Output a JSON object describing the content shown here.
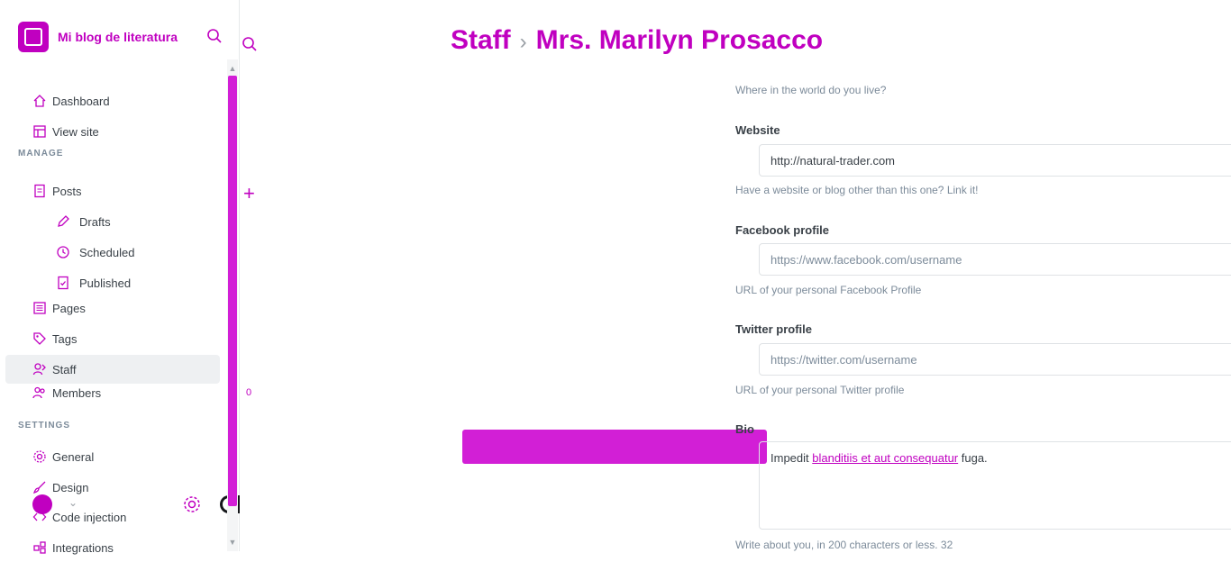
{
  "brand": {
    "name": "Mi blog de literatura",
    "logo_icon": "ghost-logo-icon"
  },
  "sidebar": {
    "search_icon": "search-icon",
    "top_items": [
      {
        "label": "Dashboard",
        "icon": "home-icon"
      },
      {
        "label": "View site",
        "icon": "layout-icon"
      }
    ],
    "manage_title": "MANAGE",
    "manage_items": [
      {
        "label": "Posts",
        "icon": "document-icon"
      },
      {
        "label": "Drafts",
        "icon": "pencil-icon"
      },
      {
        "label": "Scheduled",
        "icon": "clock-icon"
      },
      {
        "label": "Published",
        "icon": "published-icon"
      },
      {
        "label": "Pages",
        "icon": "pages-icon"
      },
      {
        "label": "Tags",
        "icon": "tag-icon"
      },
      {
        "label": "Staff",
        "icon": "staff-icon"
      },
      {
        "label": "Members",
        "icon": "members-icon"
      }
    ],
    "settings_title": "SETTINGS",
    "settings_items": [
      {
        "label": "General",
        "icon": "gear-icon"
      },
      {
        "label": "Design",
        "icon": "brush-icon"
      },
      {
        "label": "Code injection",
        "icon": "code-icon"
      },
      {
        "label": "Integrations",
        "icon": "integrations-icon"
      }
    ]
  },
  "header": {
    "section": "Staff",
    "separator": "›",
    "user": "Mrs. Marilyn Prosacco"
  },
  "gutter": {
    "add_symbol": "+",
    "count": "0"
  },
  "form": {
    "location_help": "Where in the world do you live?",
    "website": {
      "label": "Website",
      "value": "http://natural-trader.com",
      "help": "Have a website or blog other than this one? Link it!"
    },
    "facebook": {
      "label": "Facebook profile",
      "placeholder": "https://www.facebook.com/username",
      "help": "URL of your personal Facebook Profile"
    },
    "twitter": {
      "label": "Twitter profile",
      "placeholder": "https://twitter.com/username",
      "help": "URL of your personal Twitter profile"
    },
    "bio": {
      "label": "Bio",
      "value_prefix": "Impedit ",
      "value_link": "blanditiis et aut consequatur",
      "value_suffix": " fuga.",
      "help": "Write about you, in 200 characters or less. 32"
    }
  },
  "theme": {
    "accent": "#c000c0",
    "highlight": "#d21fd6"
  }
}
